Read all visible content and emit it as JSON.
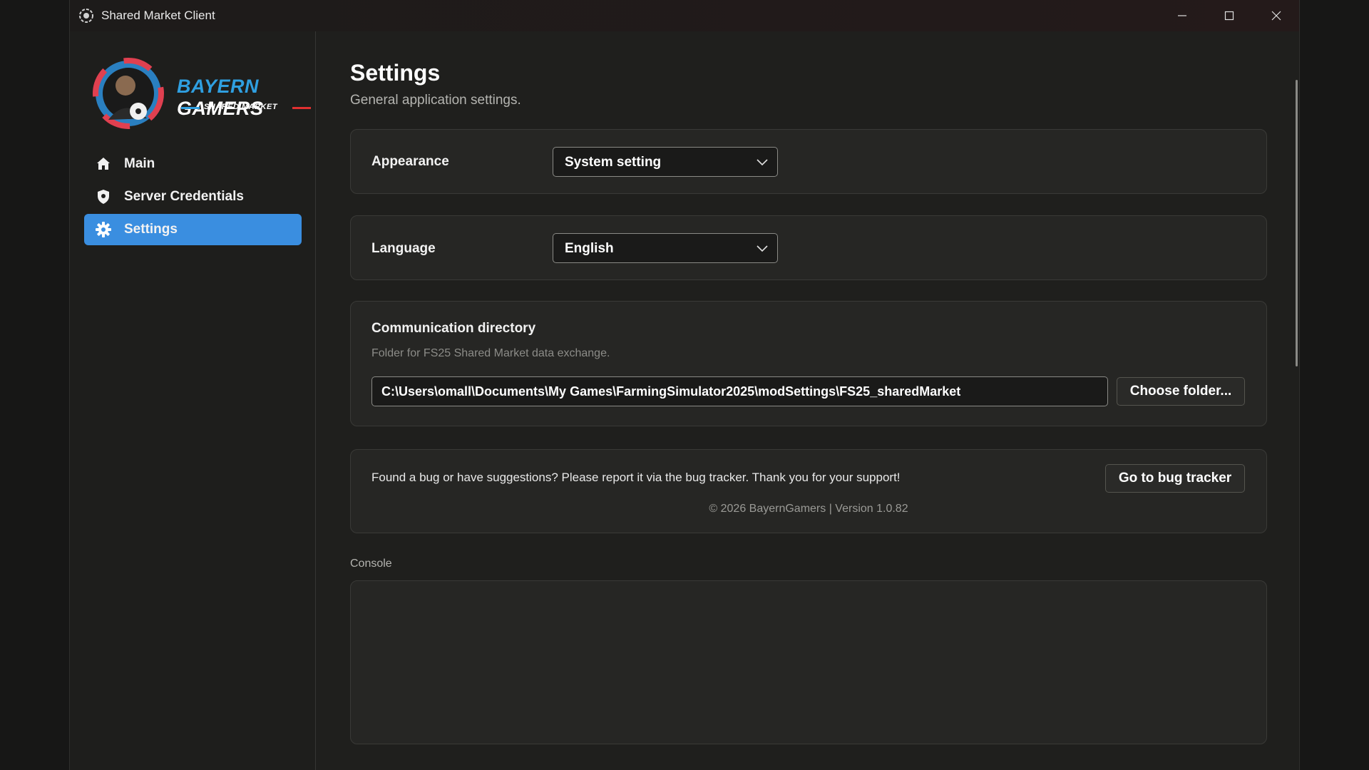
{
  "window": {
    "title": "Shared Market Client"
  },
  "logo": {
    "line1_part1": "BAYERN",
    "line1_part2": "GAMERS",
    "line2": "SHARED MARKET"
  },
  "sidebar": {
    "items": [
      {
        "label": "Main",
        "icon": "home-icon"
      },
      {
        "label": "Server Credentials",
        "icon": "shield-icon"
      },
      {
        "label": "Settings",
        "icon": "gear-icon",
        "active": true
      }
    ]
  },
  "page": {
    "title": "Settings",
    "subtitle": "General application settings."
  },
  "appearance": {
    "label": "Appearance",
    "value": "System setting"
  },
  "language": {
    "label": "Language",
    "value": "English"
  },
  "communication": {
    "title": "Communication directory",
    "description": "Folder for FS25 Shared Market data exchange.",
    "path": "C:\\Users\\omall\\Documents\\My Games\\FarmingSimulator2025\\modSettings\\FS25_sharedMarket",
    "choose_button": "Choose folder..."
  },
  "feedback": {
    "text": "Found a bug or have suggestions? Please report it via the bug tracker. Thank you for your support!",
    "button": "Go to bug tracker",
    "footer": "© 2026 BayernGamers | Version 1.0.82"
  },
  "console": {
    "label": "Console"
  },
  "colors": {
    "accent": "#3a8ee0",
    "background": "#1f1f1d",
    "card": "#262624"
  }
}
